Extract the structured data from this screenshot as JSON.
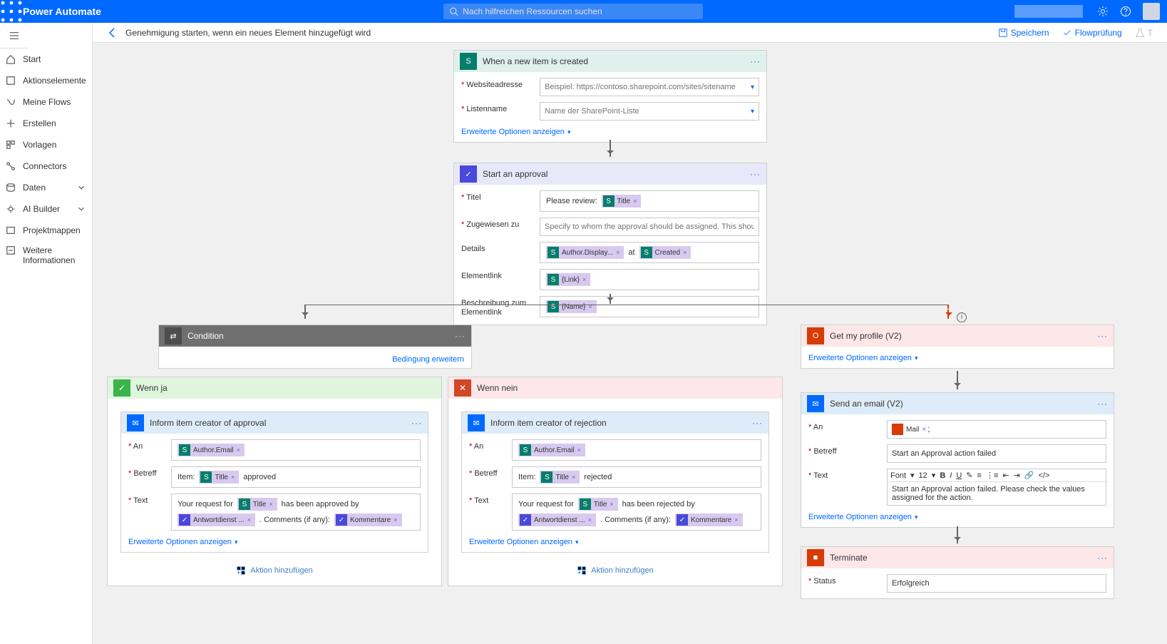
{
  "header": {
    "app_title": "Power Automate",
    "search_placeholder": "Nach hilfreichen Ressourcen suchen"
  },
  "toolbar": {
    "flow_title": "Genehmigung starten, wenn ein neues Element hinzugefügt wird",
    "save": "Speichern",
    "flowcheck": "Flowprüfung",
    "test": "T"
  },
  "sidebar": {
    "items": [
      {
        "label": "Start"
      },
      {
        "label": "Aktionselemente",
        "chev": true
      },
      {
        "label": "Meine Flows"
      },
      {
        "label": "Erstellen"
      },
      {
        "label": "Vorlagen"
      },
      {
        "label": "Connectors"
      },
      {
        "label": "Daten",
        "chev": true
      },
      {
        "label": "AI Builder",
        "chev": true
      },
      {
        "label": "Projektmappen"
      },
      {
        "label": "Weitere",
        "label2": "Informationen"
      }
    ]
  },
  "trigger": {
    "title": "When a new item is created",
    "site_label": "Websiteadresse",
    "site_ph": "Beispiel: https://contoso.sharepoint.com/sites/sitename",
    "list_label": "Listenname",
    "list_ph": "Name der SharePoint-Liste",
    "adv": "Erweiterte Optionen anzeigen"
  },
  "approval": {
    "title": "Start an approval",
    "titel": "Titel",
    "titel_pre": "Please review: ",
    "titel_tok": "Title",
    "assigned": "Zugewiesen zu",
    "assigned_ph": "Specify to whom the approval should be assigned. This should be a s",
    "details": "Details",
    "det_tok1": "Author.Display...",
    "det_mid": " at ",
    "det_tok2": "Created",
    "link": "Elementlink",
    "link_tok": "{Link}",
    "desc": "Beschreibung zum Elementlink",
    "desc_tok": "{Name}"
  },
  "condition": {
    "title": "Condition",
    "expand": "Bedingung erweitern"
  },
  "yes": {
    "title": "Wenn ja"
  },
  "no": {
    "title": "Wenn nein"
  },
  "inform_approve": {
    "title": "Inform item creator of approval",
    "an": "An",
    "an_tok": "Author.Email",
    "betreff": "Betreff",
    "bet_pre": "Item: ",
    "bet_tok": "Title",
    "bet_post": " approved",
    "text": "Text",
    "txt_pre": "Your request for ",
    "txt_tok1": "Title",
    "txt_mid": " has been approved by",
    "txt_tok2": "Antwortdienst ...",
    "txt_after": ". Comments (if any): ",
    "txt_tok3": "Kommentare",
    "adv": "Erweiterte Optionen anzeigen"
  },
  "inform_reject": {
    "title": "Inform item creator of rejection",
    "an": "An",
    "an_tok": "Author.Email",
    "betreff": "Betreff",
    "bet_pre": "Item: ",
    "bet_tok": "Title",
    "bet_post": " rejected",
    "text": "Text",
    "txt_pre": "Your request for ",
    "txt_tok1": "Title",
    "txt_mid": " has been rejected by",
    "txt_tok2": "Antwortdienst ...",
    "txt_after": ". Comments (if any): ",
    "txt_tok3": "Kommentare",
    "adv": "Erweiterte Optionen anzeigen"
  },
  "add_action": "Aktion hinzufügen",
  "getprofile": {
    "title": "Get my profile (V2)",
    "adv": "Erweiterte Optionen anzeigen"
  },
  "sendemail": {
    "title": "Send an email (V2)",
    "an": "An",
    "an_tok": "Mail",
    "an_sep": ";",
    "betreff": "Betreff",
    "bet_val": "Start an Approval action failed",
    "text": "Text",
    "font": "Font",
    "size": "12",
    "body": "Start an Approval action failed. Please check the values assigned for the action.",
    "adv": "Erweiterte Optionen anzeigen"
  },
  "terminate": {
    "title": "Terminate",
    "status": "Status",
    "val": "Erfolgreich"
  }
}
